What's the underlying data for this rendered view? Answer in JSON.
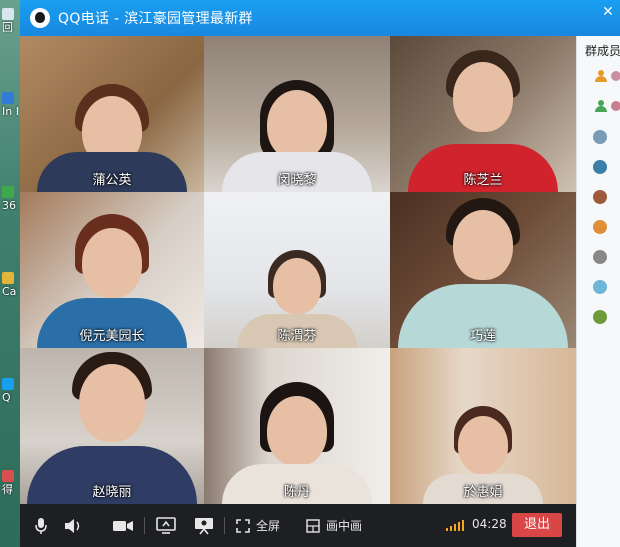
{
  "window": {
    "title": "QQ电话 - 滨江豪园管理最新群",
    "close_glyph": "✕"
  },
  "desktop_icons": [
    {
      "label": "回",
      "icon": "recycle-bin-icon",
      "color": "#d8e6f0"
    },
    {
      "label": "In Ex",
      "icon": "internet-explorer-icon",
      "color": "#2f7bd6"
    },
    {
      "label": "36",
      "icon": "360-icon",
      "color": "#3da94b"
    },
    {
      "label": "Ca St",
      "icon": "app-icon",
      "color": "#e2b43a"
    },
    {
      "label": "Q",
      "icon": "qq-icon",
      "color": "#1a9ff0"
    },
    {
      "label": "得",
      "icon": "app-icon",
      "color": "#d94f4f"
    }
  ],
  "participants": [
    {
      "name": "蒲公英",
      "bg": "#b08a62",
      "shirt": "#2e3a5a"
    },
    {
      "name": "闵晓黎",
      "bg": "#9a8f86",
      "shirt": "#e6e6ea"
    },
    {
      "name": "陈芝兰",
      "bg": "#7a6a5a",
      "shirt": "#d0232c"
    },
    {
      "name": "倪元美园长",
      "bg": "#d7cfc7",
      "shirt": "#2b6fa8"
    },
    {
      "name": "陈渭芬",
      "bg": "#e9eaec",
      "shirt": "#d8c7b2"
    },
    {
      "name": "巧莲",
      "bg": "#6b4a36",
      "shirt": "#b6d9d8"
    },
    {
      "name": "赵晓丽",
      "bg": "#c9c2ba",
      "shirt": "#2f3c63"
    },
    {
      "name": "陈丹",
      "bg": "#dcd6cf",
      "shirt": "#e9e3dc"
    },
    {
      "name": "於惠娟",
      "bg": "#d7b798",
      "shirt": "#e3dad2"
    }
  ],
  "members_panel": {
    "title": "群成员",
    "avatar_colors": [
      "#e69a2a",
      "#4aa558",
      "#7a9bb5",
      "#3b7ea8",
      "#9c5a3a",
      "#e08e3a",
      "#888888",
      "#6fb7d8",
      "#6f9a3a"
    ]
  },
  "controls": {
    "mic_icon": "microphone-icon",
    "speaker_icon": "speaker-icon",
    "camera_icon": "camera-icon",
    "share_icon": "screen-share-icon",
    "present_icon": "presentation-icon",
    "fullscreen_label": "全屏",
    "pip_label": "画中画",
    "timer": "04:28",
    "exit_label": "退出",
    "accent": "#d84646",
    "signal_color": "#f5a623"
  }
}
